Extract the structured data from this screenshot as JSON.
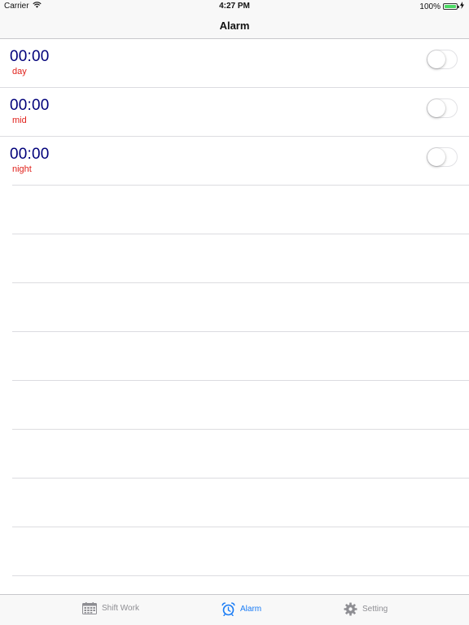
{
  "status_bar": {
    "carrier": "Carrier",
    "time": "4:27 PM",
    "battery_percent": "100%",
    "battery_level": 1.0
  },
  "nav": {
    "title": "Alarm"
  },
  "alarms": [
    {
      "time": "00:00",
      "label": "day",
      "enabled": false
    },
    {
      "time": "00:00",
      "label": "mid",
      "enabled": false
    },
    {
      "time": "00:00",
      "label": "night",
      "enabled": false
    }
  ],
  "empty_rows": 8,
  "tabs": [
    {
      "label": "Shift Work",
      "icon": "calendar-icon",
      "active": false
    },
    {
      "label": "Alarm",
      "icon": "alarm-clock-icon",
      "active": true
    },
    {
      "label": "Setting",
      "icon": "gear-icon",
      "active": false
    }
  ],
  "colors": {
    "time_text": "#00007a",
    "label_text": "#e0201a",
    "tab_active": "#1a7cf5",
    "tab_inactive": "#8e8e93",
    "battery_fill": "#4cd964"
  }
}
